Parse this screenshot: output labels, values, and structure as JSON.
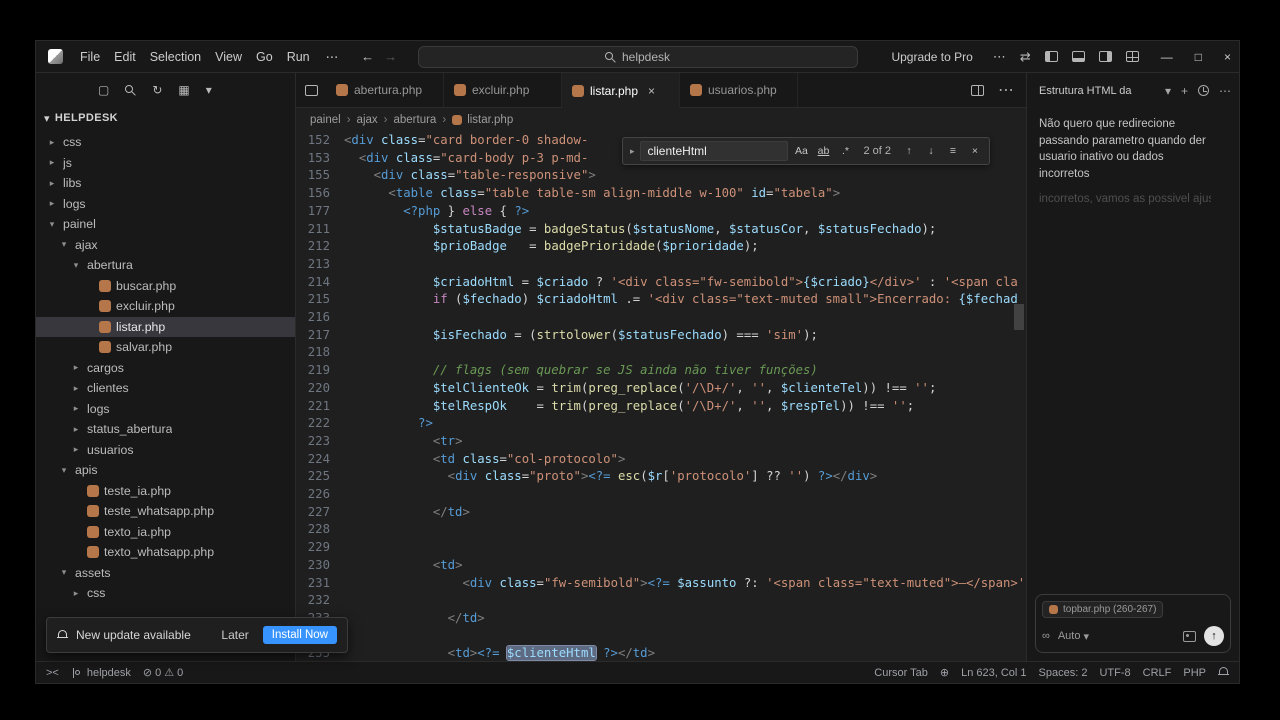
{
  "colors": {
    "accent": "#3794ff",
    "php_icon": "#b5764a",
    "find_match_bg": "#5d6a82",
    "selected_row": "#37373d"
  },
  "icons": {
    "back": "←",
    "forward": "→",
    "more": "⋯",
    "sync": "⇄",
    "minimize": "—",
    "restore": "□",
    "close": "×",
    "chevron_down": "▾",
    "chevron_right": "▸",
    "plus": "+",
    "up": "↑",
    "down": "↓",
    "find_selection": "≡",
    "infinity": "∞",
    "remote": "><",
    "error": "⊘",
    "warning": "⚠",
    "globe": "⊕",
    "new_file": "▢",
    "refresh": "↻",
    "grid": "▦",
    "send": "↑",
    "breadcrumb_sep": "›"
  },
  "titlebar": {
    "menus": [
      "File",
      "Edit",
      "Selection",
      "View",
      "Go",
      "Run"
    ],
    "search": "helpdesk",
    "upgrade": "Upgrade to Pro"
  },
  "sidebar": {
    "title": "HELPDESK",
    "tree": [
      {
        "label": "css",
        "depth": 0,
        "kind": "folder",
        "exp": false
      },
      {
        "label": "js",
        "depth": 0,
        "kind": "folder",
        "exp": false
      },
      {
        "label": "libs",
        "depth": 0,
        "kind": "folder",
        "exp": false
      },
      {
        "label": "logs",
        "depth": 0,
        "kind": "folder",
        "exp": false
      },
      {
        "label": "painel",
        "depth": 0,
        "kind": "folder",
        "exp": true
      },
      {
        "label": "ajax",
        "depth": 1,
        "kind": "folder",
        "exp": true
      },
      {
        "label": "abertura",
        "depth": 2,
        "kind": "folder",
        "exp": true
      },
      {
        "label": "buscar.php",
        "depth": 3,
        "kind": "php"
      },
      {
        "label": "excluir.php",
        "depth": 3,
        "kind": "php"
      },
      {
        "label": "listar.php",
        "depth": 3,
        "kind": "php",
        "selected": true
      },
      {
        "label": "salvar.php",
        "depth": 3,
        "kind": "php"
      },
      {
        "label": "cargos",
        "depth": 2,
        "kind": "folder",
        "exp": false
      },
      {
        "label": "clientes",
        "depth": 2,
        "kind": "folder",
        "exp": false
      },
      {
        "label": "logs",
        "depth": 2,
        "kind": "folder",
        "exp": false
      },
      {
        "label": "status_abertura",
        "depth": 2,
        "kind": "folder",
        "exp": false
      },
      {
        "label": "usuarios",
        "depth": 2,
        "kind": "folder",
        "exp": false
      },
      {
        "label": "apis",
        "depth": 1,
        "kind": "folder",
        "exp": true
      },
      {
        "label": "teste_ia.php",
        "depth": 2,
        "kind": "php"
      },
      {
        "label": "teste_whatsapp.php",
        "depth": 2,
        "kind": "php"
      },
      {
        "label": "texto_ia.php",
        "depth": 2,
        "kind": "php"
      },
      {
        "label": "texto_whatsapp.php",
        "depth": 2,
        "kind": "php"
      },
      {
        "label": "assets",
        "depth": 1,
        "kind": "folder",
        "exp": true
      },
      {
        "label": "css",
        "depth": 2,
        "kind": "folder",
        "exp": false
      }
    ]
  },
  "tabs": [
    {
      "label": "abertura.php",
      "active": false
    },
    {
      "label": "excluir.php",
      "active": false
    },
    {
      "label": "listar.php",
      "active": true
    },
    {
      "label": "usuarios.php",
      "active": false
    }
  ],
  "breadcrumb": [
    "painel",
    "ajax",
    "abertura",
    "listar.php"
  ],
  "find": {
    "value": "clienteHtml",
    "results": "2 of 2",
    "case_label": "Aa",
    "word_label": "ab",
    "regex_label": ".*"
  },
  "editor": {
    "lines": [
      {
        "n": "152",
        "tk": [
          [
            "g",
            "<"
          ],
          [
            "t",
            "div"
          ],
          [
            "o",
            " "
          ],
          [
            "a",
            "class"
          ],
          [
            "o",
            "="
          ],
          [
            "s",
            "\"card border-0 shadow-"
          ]
        ]
      },
      {
        "n": "153",
        "tk": [
          [
            "o",
            "  "
          ],
          [
            "g",
            "<"
          ],
          [
            "t",
            "div"
          ],
          [
            "o",
            " "
          ],
          [
            "a",
            "class"
          ],
          [
            "o",
            "="
          ],
          [
            "s",
            "\"card-body p-3 p-md-"
          ]
        ]
      },
      {
        "n": "155",
        "tk": [
          [
            "o",
            "    "
          ],
          [
            "g",
            "<"
          ],
          [
            "t",
            "div"
          ],
          [
            "o",
            " "
          ],
          [
            "a",
            "class"
          ],
          [
            "o",
            "="
          ],
          [
            "s",
            "\"table-responsive\""
          ],
          [
            "g",
            ">"
          ]
        ]
      },
      {
        "n": "156",
        "tk": [
          [
            "o",
            "      "
          ],
          [
            "g",
            "<"
          ],
          [
            "t",
            "table"
          ],
          [
            "o",
            " "
          ],
          [
            "a",
            "class"
          ],
          [
            "o",
            "="
          ],
          [
            "s",
            "\"table table-sm align-middle w-100\""
          ],
          [
            "o",
            " "
          ],
          [
            "a",
            "id"
          ],
          [
            "o",
            "="
          ],
          [
            "s",
            "\"tabela\""
          ],
          [
            "g",
            ">"
          ]
        ]
      },
      {
        "n": "177",
        "tk": [
          [
            "o",
            "        "
          ],
          [
            "k2",
            "<?php"
          ],
          [
            "o",
            " } "
          ],
          [
            "k",
            "else"
          ],
          [
            "o",
            " { "
          ],
          [
            "k2",
            "?>"
          ]
        ]
      },
      {
        "n": "211",
        "tk": [
          [
            "o",
            "            "
          ],
          [
            "v",
            "$statusBadge"
          ],
          [
            "o",
            " = "
          ],
          [
            "f",
            "badgeStatus"
          ],
          [
            "o",
            "("
          ],
          [
            "v",
            "$statusNome"
          ],
          [
            "o",
            ", "
          ],
          [
            "v",
            "$statusCor"
          ],
          [
            "o",
            ", "
          ],
          [
            "v",
            "$statusFechado"
          ],
          [
            "o",
            ");"
          ]
        ]
      },
      {
        "n": "212",
        "tk": [
          [
            "o",
            "            "
          ],
          [
            "v",
            "$prioBadge"
          ],
          [
            "o",
            "   = "
          ],
          [
            "f",
            "badgePrioridade"
          ],
          [
            "o",
            "("
          ],
          [
            "v",
            "$prioridade"
          ],
          [
            "o",
            ");"
          ]
        ]
      },
      {
        "n": "213",
        "tk": []
      },
      {
        "n": "214",
        "tk": [
          [
            "o",
            "            "
          ],
          [
            "v",
            "$criadoHtml"
          ],
          [
            "o",
            " = "
          ],
          [
            "v",
            "$criado"
          ],
          [
            "o",
            " ? "
          ],
          [
            "s",
            "'<div class=\"fw-semibold\">"
          ],
          [
            "v",
            "{$criado}"
          ],
          [
            "s",
            "</div>'"
          ],
          [
            "o",
            " : "
          ],
          [
            "s",
            "'<span cla"
          ]
        ]
      },
      {
        "n": "215",
        "tk": [
          [
            "o",
            "            "
          ],
          [
            "k",
            "if"
          ],
          [
            "o",
            " ("
          ],
          [
            "v",
            "$fechado"
          ],
          [
            "o",
            ") "
          ],
          [
            "v",
            "$criadoHtml"
          ],
          [
            "o",
            " .= "
          ],
          [
            "s",
            "'<div class=\"text-muted small\">Encerrado: "
          ],
          [
            "v",
            "{$fechad"
          ]
        ]
      },
      {
        "n": "216",
        "tk": []
      },
      {
        "n": "217",
        "tk": [
          [
            "o",
            "            "
          ],
          [
            "v",
            "$isFechado"
          ],
          [
            "o",
            " = ("
          ],
          [
            "f",
            "strtolower"
          ],
          [
            "o",
            "("
          ],
          [
            "v",
            "$statusFechado"
          ],
          [
            "o",
            ") === "
          ],
          [
            "s",
            "'sim'"
          ],
          [
            "o",
            ");"
          ]
        ]
      },
      {
        "n": "218",
        "tk": []
      },
      {
        "n": "219",
        "tk": [
          [
            "o",
            "            "
          ],
          [
            "c",
            "// flags (sem quebrar se JS ainda não tiver funções)"
          ]
        ]
      },
      {
        "n": "220",
        "tk": [
          [
            "o",
            "            "
          ],
          [
            "v",
            "$telClienteOk"
          ],
          [
            "o",
            " = "
          ],
          [
            "f",
            "trim"
          ],
          [
            "o",
            "("
          ],
          [
            "f",
            "preg_replace"
          ],
          [
            "o",
            "("
          ],
          [
            "s",
            "'/\\D+/'"
          ],
          [
            "o",
            ", "
          ],
          [
            "s",
            "''"
          ],
          [
            "o",
            ", "
          ],
          [
            "v",
            "$clienteTel"
          ],
          [
            "o",
            ")) !== "
          ],
          [
            "s",
            "''"
          ],
          [
            "o",
            ";"
          ]
        ]
      },
      {
        "n": "221",
        "tk": [
          [
            "o",
            "            "
          ],
          [
            "v",
            "$telRespOk"
          ],
          [
            "o",
            "    = "
          ],
          [
            "f",
            "trim"
          ],
          [
            "o",
            "("
          ],
          [
            "f",
            "preg_replace"
          ],
          [
            "o",
            "("
          ],
          [
            "s",
            "'/\\D+/'"
          ],
          [
            "o",
            ", "
          ],
          [
            "s",
            "''"
          ],
          [
            "o",
            ", "
          ],
          [
            "v",
            "$respTel"
          ],
          [
            "o",
            ")) !== "
          ],
          [
            "s",
            "''"
          ],
          [
            "o",
            ";"
          ]
        ]
      },
      {
        "n": "222",
        "tk": [
          [
            "o",
            "          "
          ],
          [
            "k2",
            "?>"
          ]
        ]
      },
      {
        "n": "223",
        "tk": [
          [
            "o",
            "            "
          ],
          [
            "g",
            "<"
          ],
          [
            "t",
            "tr"
          ],
          [
            "g",
            ">"
          ]
        ]
      },
      {
        "n": "224",
        "tk": [
          [
            "o",
            "            "
          ],
          [
            "g",
            "<"
          ],
          [
            "t",
            "td"
          ],
          [
            "o",
            " "
          ],
          [
            "a",
            "class"
          ],
          [
            "o",
            "="
          ],
          [
            "s",
            "\"col-protocolo\""
          ],
          [
            "g",
            ">"
          ]
        ]
      },
      {
        "n": "225",
        "tk": [
          [
            "o",
            "              "
          ],
          [
            "g",
            "<"
          ],
          [
            "t",
            "div"
          ],
          [
            "o",
            " "
          ],
          [
            "a",
            "class"
          ],
          [
            "o",
            "="
          ],
          [
            "s",
            "\"proto\""
          ],
          [
            "g",
            ">"
          ],
          [
            "k2",
            "<?="
          ],
          [
            "o",
            " "
          ],
          [
            "f",
            "esc"
          ],
          [
            "o",
            "("
          ],
          [
            "v",
            "$r"
          ],
          [
            "o",
            "["
          ],
          [
            "s",
            "'protocolo'"
          ],
          [
            "o",
            "] ?? "
          ],
          [
            "s",
            "''"
          ],
          [
            "o",
            ") "
          ],
          [
            "k2",
            "?>"
          ],
          [
            "g",
            "</"
          ],
          [
            "t",
            "div"
          ],
          [
            "g",
            ">"
          ]
        ]
      },
      {
        "n": "226",
        "tk": []
      },
      {
        "n": "227",
        "tk": [
          [
            "o",
            "            "
          ],
          [
            "g",
            "</"
          ],
          [
            "t",
            "td"
          ],
          [
            "g",
            ">"
          ]
        ]
      },
      {
        "n": "228",
        "tk": []
      },
      {
        "n": "229",
        "tk": []
      },
      {
        "n": "230",
        "tk": [
          [
            "o",
            "            "
          ],
          [
            "g",
            "<"
          ],
          [
            "t",
            "td"
          ],
          [
            "g",
            ">"
          ]
        ]
      },
      {
        "n": "231",
        "tk": [
          [
            "o",
            "                "
          ],
          [
            "g",
            "<"
          ],
          [
            "t",
            "div"
          ],
          [
            "o",
            " "
          ],
          [
            "a",
            "class"
          ],
          [
            "o",
            "="
          ],
          [
            "s",
            "\"fw-semibold\""
          ],
          [
            "g",
            ">"
          ],
          [
            "k2",
            "<?="
          ],
          [
            "o",
            " "
          ],
          [
            "v",
            "$assunto"
          ],
          [
            "o",
            " ?: "
          ],
          [
            "s",
            "'<span class=\"text-muted\">—</span>'"
          ]
        ]
      },
      {
        "n": "232",
        "tk": []
      },
      {
        "n": "233",
        "tk": [
          [
            "o",
            "              "
          ],
          [
            "g",
            "</"
          ],
          [
            "t",
            "td"
          ],
          [
            "g",
            ">"
          ]
        ]
      },
      {
        "n": "234",
        "tk": []
      },
      {
        "n": "235",
        "tk": [
          [
            "o",
            "              "
          ],
          [
            "g",
            "<"
          ],
          [
            "t",
            "td"
          ],
          [
            "g",
            ">"
          ],
          [
            "k2",
            "<?="
          ],
          [
            "o",
            " "
          ],
          [
            "vm",
            "$clienteHtml"
          ],
          [
            "o",
            " "
          ],
          [
            "k2",
            "?>"
          ],
          [
            "g",
            "</"
          ],
          [
            "t",
            "td"
          ],
          [
            "g",
            ">"
          ]
        ]
      }
    ]
  },
  "chat": {
    "title": "Estrutura HTML da",
    "message": "Não quero que redirecione passando parametro quando der usuario inativo ou dados incorretos",
    "faded": "incorretos, vamos as possivel ajus",
    "chip": "topbar.php (260-267)",
    "model": "Auto"
  },
  "toast": {
    "text": "New update available",
    "later": "Later",
    "install": "Install Now"
  },
  "statusbar": {
    "branch": "helpdesk",
    "errors": "0",
    "warnings": "0",
    "cursor_tab": "Cursor Tab",
    "line_col": "Ln 623, Col 1",
    "spaces": "Spaces: 2",
    "encoding": "UTF-8",
    "eol": "CRLF",
    "lang": "PHP"
  }
}
